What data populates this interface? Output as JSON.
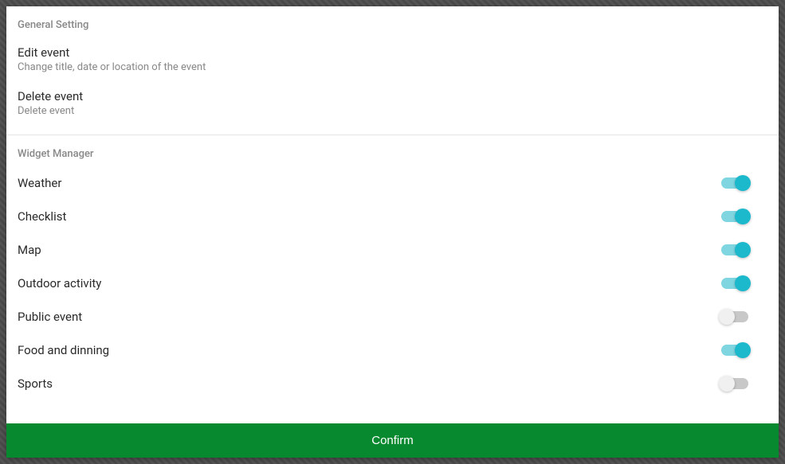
{
  "sections": {
    "general": {
      "header": "General Setting",
      "items": [
        {
          "title": "Edit event",
          "subtitle": "Change title, date or location of the event"
        },
        {
          "title": "Delete event",
          "subtitle": "Delete event"
        }
      ]
    },
    "widgets": {
      "header": "Widget Manager",
      "items": [
        {
          "label": "Weather",
          "on": true
        },
        {
          "label": "Checklist",
          "on": true
        },
        {
          "label": "Map",
          "on": true
        },
        {
          "label": "Outdoor activity",
          "on": true
        },
        {
          "label": "Public event",
          "on": false
        },
        {
          "label": "Food and dinning",
          "on": true
        },
        {
          "label": "Sports",
          "on": false
        }
      ]
    }
  },
  "confirm_label": "Confirm"
}
